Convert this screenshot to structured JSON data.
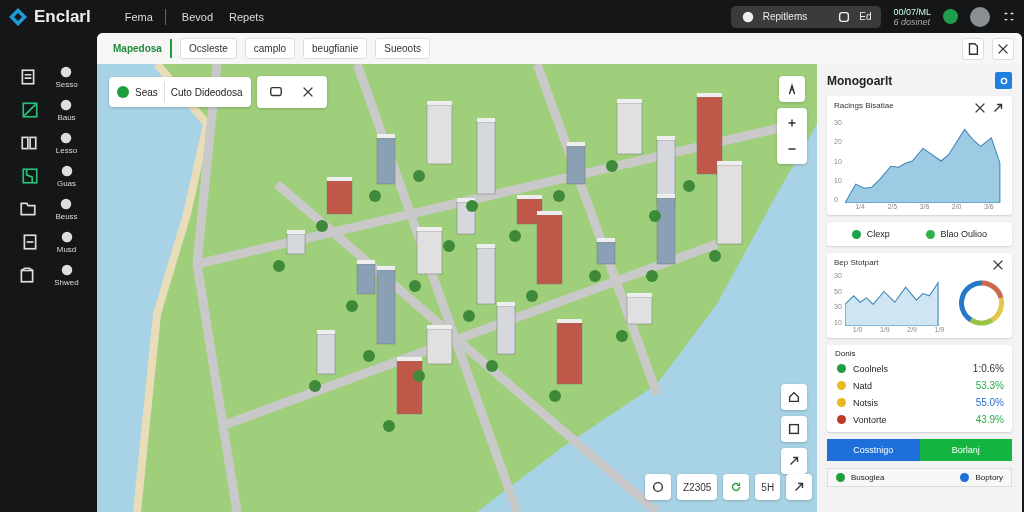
{
  "topbar": {
    "brand": "Enclarl",
    "nav": [
      "Fema",
      "Bevod",
      "Repets"
    ],
    "status_pill": {
      "label": "Repitlems",
      "count": "Ed"
    },
    "clock": {
      "time": "00/07/ML",
      "sub": "6 dosinet"
    }
  },
  "sidebar": {
    "items": [
      {
        "label": "Sesso",
        "selected": false
      },
      {
        "label": "Baus",
        "selected": true
      },
      {
        "label": "Lesso",
        "selected": false
      },
      {
        "label": "Guas",
        "selected": true
      },
      {
        "label": "Beuss",
        "selected": false
      },
      {
        "label": "Musd",
        "selected": false
      },
      {
        "label": "Shwed",
        "selected": false
      }
    ]
  },
  "tabs": [
    {
      "label": "Mapedosa",
      "selected": true
    },
    {
      "label": "Ocsleste",
      "selected": false
    },
    {
      "label": "camplo",
      "selected": false
    },
    {
      "label": "beugfianie",
      "selected": false
    },
    {
      "label": "Sueoots",
      "selected": false
    }
  ],
  "map": {
    "search": {
      "status": "Seas",
      "value": "Cuto Dideodosa"
    },
    "zoom": "Z2305",
    "scale": "5H"
  },
  "panel": {
    "title": "Monogoarlt",
    "chart_card": {
      "title": "Racings Bisatiae",
      "y_labels": [
        "30",
        "20",
        "10",
        "10",
        "0"
      ],
      "x_labels": [
        "1/4",
        "2/5",
        "3/6",
        "2/0",
        "3/6"
      ]
    },
    "legend": [
      {
        "label": "Clexp",
        "color": "#1aa34a"
      },
      {
        "label": "Blao Oulioo",
        "color": "#2fb24a"
      }
    ],
    "trend_card": {
      "title": "Bep Stotpart",
      "y_labels": [
        "30",
        "50",
        "30",
        "10"
      ],
      "x_labels": [
        "1/0",
        "1/9",
        "2/9",
        "1/9"
      ]
    },
    "list": {
      "title": "Donis",
      "rows": [
        {
          "label": "Coolnels",
          "value": "1:0.6%",
          "color": "#1f9e3e",
          "kind": "neutral"
        },
        {
          "label": "Natd",
          "value": "53.3%",
          "color": "#e8b923",
          "kind": "up"
        },
        {
          "label": "Notsis",
          "value": "55.0%",
          "color": "#e8b923",
          "kind": "info"
        },
        {
          "label": "Vontorte",
          "value": "43.9%",
          "color": "#c0392b",
          "kind": "up"
        }
      ]
    },
    "buttons": [
      {
        "label": "Cosstnigo",
        "kind": "primary"
      },
      {
        "label": "Borlanj",
        "kind": "success"
      }
    ],
    "footer": [
      {
        "label": "Busoglea",
        "color": "#1f9e3e"
      },
      {
        "label": "Boptory",
        "color": "#1e6fd9"
      }
    ]
  }
}
